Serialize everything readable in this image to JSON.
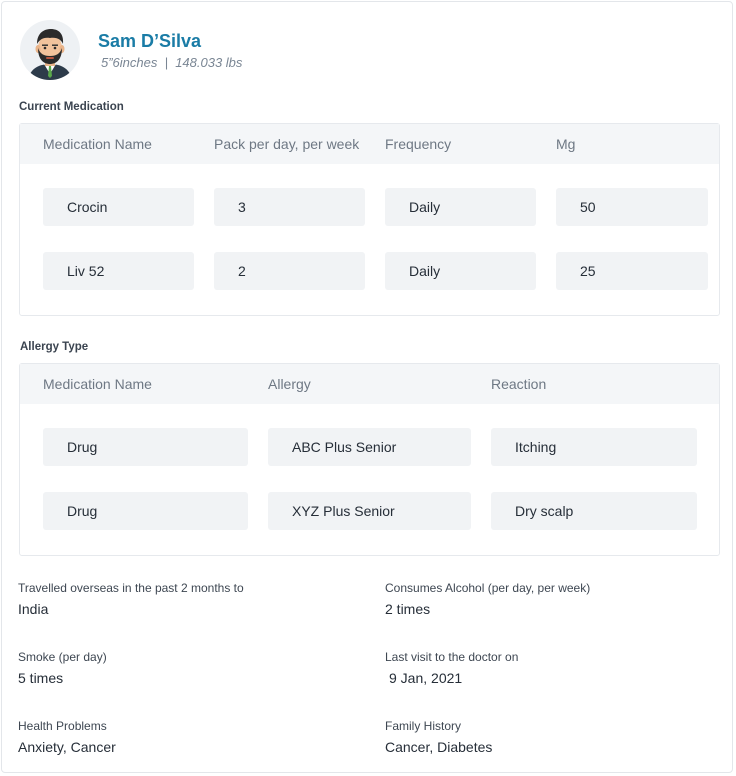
{
  "patient": {
    "name": "Sam D’Silva",
    "meta": "5”6inches  |  148.033 lbs",
    "avatar_icon": "bearded-man-avatar"
  },
  "current_medication": {
    "title": "Current Medication",
    "headers": [
      "Medication Name",
      "Pack per day, per week",
      "Frequency",
      "Mg"
    ],
    "rows": [
      [
        "Crocin",
        "3",
        "Daily",
        "50"
      ],
      [
        "Liv 52",
        "2",
        "Daily",
        "25"
      ]
    ]
  },
  "allergy": {
    "title": "Allergy Type",
    "headers": [
      "Medication Name",
      "Allergy",
      "Reaction"
    ],
    "rows": [
      [
        "Drug",
        "ABC Plus Senior",
        "Itching"
      ],
      [
        "Drug",
        "XYZ Plus Senior",
        "Dry scalp"
      ]
    ]
  },
  "info": {
    "travel_label": "Travelled overseas in the past 2 months to",
    "travel_value": "India",
    "alcohol_label": "Consumes Alcohol (per day, per week)",
    "alcohol_value": "2 times",
    "smoke_label": "Smoke (per day)",
    "smoke_value": "5 times",
    "visit_label": "Last visit to the doctor on",
    "visit_value": "9 Jan, 2021",
    "health_label": "Health Problems",
    "health_value": "Anxiety, Cancer",
    "family_label": "Family History",
    "family_value": "Cancer, Diabetes"
  },
  "colors": {
    "accent": "#1a7ca6",
    "cell_bg": "#f1f3f5",
    "header_bg": "#f4f6f8"
  }
}
